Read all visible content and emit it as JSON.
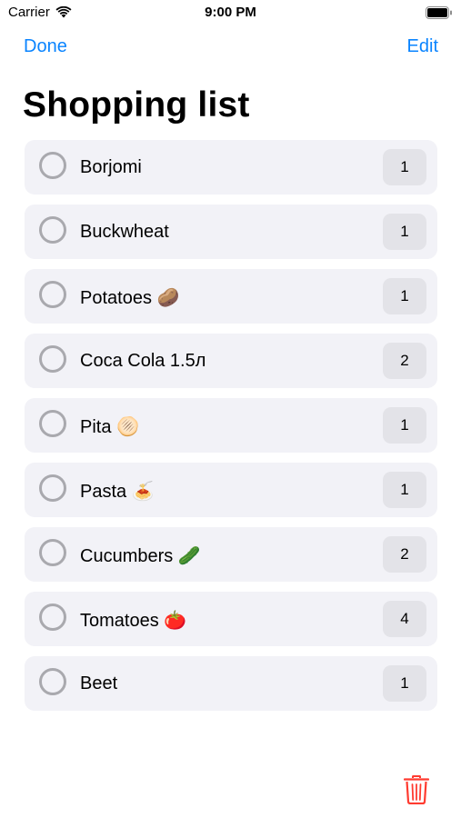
{
  "status_bar": {
    "carrier": "Carrier",
    "time": "9:00 PM"
  },
  "nav": {
    "left_label": "Done",
    "right_label": "Edit"
  },
  "title": "Shopping list",
  "items": [
    {
      "label": "Borjomi",
      "quantity": "1"
    },
    {
      "label": "Buckwheat",
      "quantity": "1"
    },
    {
      "label": "Potatoes 🥔",
      "quantity": "1"
    },
    {
      "label": "Coca Cola 1.5л",
      "quantity": "2"
    },
    {
      "label": "Pita 🫓",
      "quantity": "1"
    },
    {
      "label": "Pasta 🍝",
      "quantity": "1"
    },
    {
      "label": "Cucumbers 🥒",
      "quantity": "2"
    },
    {
      "label": "Tomatoes 🍅",
      "quantity": "4"
    },
    {
      "label": "Beet",
      "quantity": "1"
    }
  ],
  "icons": {
    "wifi": "wifi-icon",
    "battery": "battery-icon",
    "check": "circle-checkbox-icon",
    "trash": "trash-icon"
  },
  "colors": {
    "accent": "#0a84ff",
    "delete": "#ff3b30",
    "row_background": "#f2f2f7",
    "badge_background": "#e3e3e8",
    "checkbox_border": "#a9a9ae"
  }
}
